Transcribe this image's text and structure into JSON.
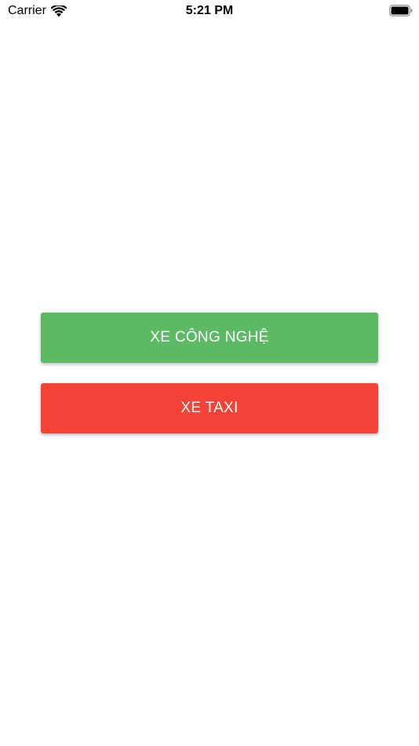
{
  "status_bar": {
    "carrier": "Carrier",
    "time": "5:21 PM",
    "icons": [
      "wifi-icon",
      "battery-icon"
    ]
  },
  "buttons": {
    "tech_car": {
      "label": "XE CÔNG NGHỆ",
      "color": "#5cb964"
    },
    "taxi": {
      "label": "XE TAXI",
      "color": "#f44336"
    }
  }
}
